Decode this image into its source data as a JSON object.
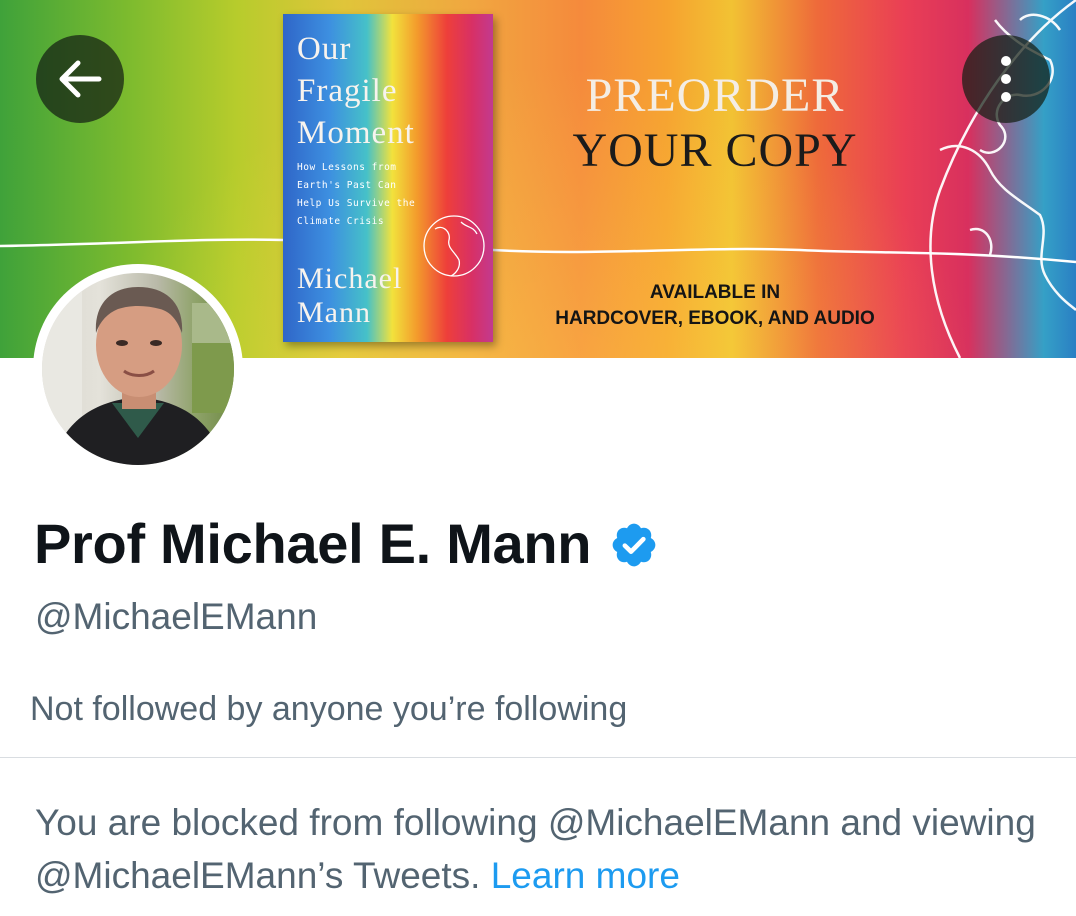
{
  "header": {
    "back_icon": "arrow-left-icon",
    "more_icon": "more-vertical-icon"
  },
  "banner": {
    "book": {
      "title_line1": "Our",
      "title_line2": "Fragile",
      "title_line3": "Moment",
      "subtitle_line1": "How Lessons from",
      "subtitle_line2": "Earth's Past Can",
      "subtitle_line3": "Help Us Survive the",
      "subtitle_line4": "Climate Crisis",
      "author_line1": "Michael",
      "author_line2": "Mann"
    },
    "preorder_line1": "PREORDER",
    "preorder_line2": "YOUR COPY",
    "available_line1": "AVAILABLE IN",
    "available_line2": "HARDCOVER, EBOOK, AND AUDIO"
  },
  "profile": {
    "display_name": "Prof Michael E. Mann",
    "verified_icon": "verified-badge-icon",
    "handle": "@MichaelEMann",
    "followers_note": "Not followed by anyone you’re following"
  },
  "blocked_notice": {
    "text": "You are blocked from following @MichaelEMann and viewing @MichaelEMann’s Tweets.",
    "link_label": "Learn more"
  },
  "colors": {
    "text_primary": "#0f1419",
    "text_secondary": "#536471",
    "link": "#1d9bf0",
    "verified": "#1d9bf0",
    "divider": "#d9dde1"
  }
}
